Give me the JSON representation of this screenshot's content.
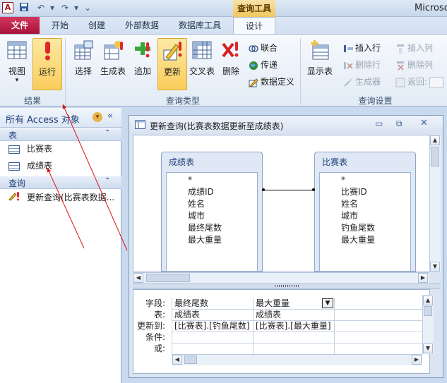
{
  "window": {
    "title": "Microso",
    "context_tab": "查询工具"
  },
  "tabs": [
    "文件",
    "开始",
    "创建",
    "外部数据",
    "数据库工具",
    "设计"
  ],
  "ribbon": {
    "results": {
      "label": "结果",
      "view": "视图",
      "run": "运行"
    },
    "query_type": {
      "label": "查询类型",
      "select": "选择",
      "make_table": "生成表",
      "append": "追加",
      "update": "更新",
      "crosstab": "交叉表",
      "delete": "删除",
      "union": "联合",
      "passthrough": "传递",
      "data_definition": "数据定义"
    },
    "query_setup": {
      "label": "查询设置",
      "show_table": "显示表",
      "insert_rows": "插入行",
      "delete_rows": "删除行",
      "builder": "生成器",
      "insert_columns": "插入列",
      "delete_columns": "删除列",
      "return": "返回:"
    }
  },
  "nav": {
    "header": "所有 Access 对象",
    "sections": [
      {
        "title": "表",
        "items": [
          "比赛表",
          "成绩表"
        ]
      },
      {
        "title": "查询",
        "items": [
          "更新查询(比赛表数据..."
        ]
      }
    ]
  },
  "query_window": {
    "title": "更新查询(比赛表数据更新至成绩表)",
    "tables": [
      {
        "name": "成绩表",
        "fields": [
          "*",
          "成绩ID",
          "姓名",
          "城市",
          "最终尾数",
          "最大重量"
        ]
      },
      {
        "name": "比赛表",
        "fields": [
          "*",
          "比赛ID",
          "姓名",
          "城市",
          "钓鱼尾数",
          "最大重量"
        ]
      }
    ],
    "grid": {
      "row_labels": [
        "字段:",
        "表:",
        "更新到:",
        "条件:",
        "或:"
      ],
      "columns": [
        {
          "field": "最终尾数",
          "table": "成绩表",
          "update_to": "[比赛表].[钓鱼尾数]"
        },
        {
          "field": "最大重量",
          "table": "成绩表",
          "update_to": "[比赛表].[最大重量]"
        }
      ]
    }
  }
}
